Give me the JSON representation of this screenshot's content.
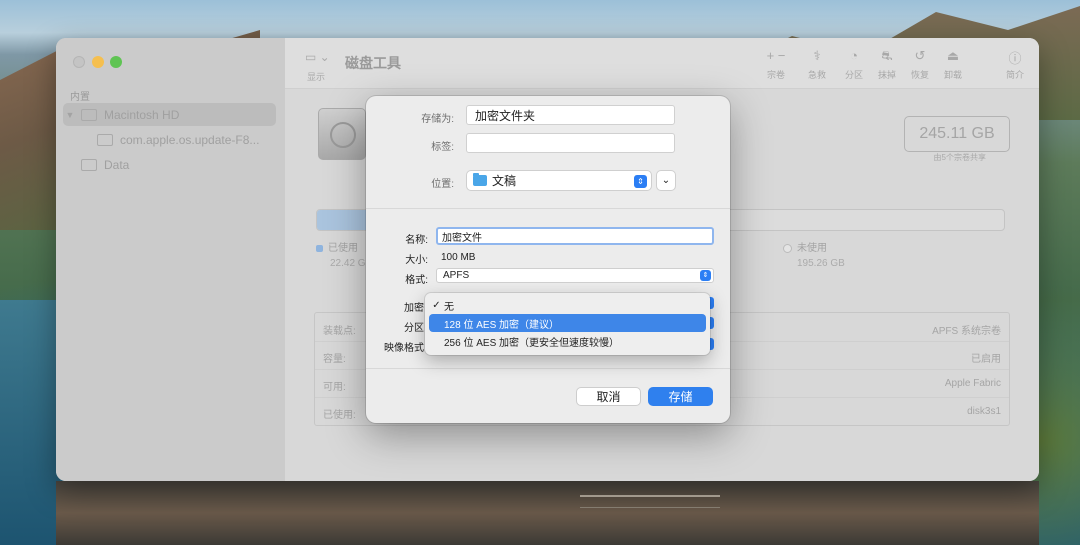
{
  "window": {
    "title": "磁盘工具",
    "show_label": "显示"
  },
  "toolbar": {
    "tools": [
      {
        "icon": "plus-minus-icon",
        "glyph": "+ −",
        "label": "宗卷"
      },
      {
        "icon": "stethoscope-icon",
        "glyph": "⚕",
        "label": "急救"
      },
      {
        "icon": "pie-icon",
        "glyph": "◔",
        "label": "分区"
      },
      {
        "icon": "car-icon",
        "glyph": "⛐",
        "label": "抹掉"
      },
      {
        "icon": "restore-icon",
        "glyph": "↺",
        "label": "恢复"
      },
      {
        "icon": "eject-icon",
        "glyph": "⏏",
        "label": "卸载"
      },
      {
        "icon": "info-icon",
        "glyph": "ⓘ",
        "label": "简介"
      }
    ]
  },
  "sidebar": {
    "section": "内置",
    "items": [
      {
        "label": "Macintosh HD",
        "selected": true
      },
      {
        "label": "com.apple.os.update-F8..."
      },
      {
        "label": "Data"
      }
    ]
  },
  "volume": {
    "capacity": "245.11 GB",
    "capacity_sub": "由5个宗卷共享",
    "used_fraction": 0.091,
    "legend_used": "已使用",
    "legend_used_value": "22.42 G",
    "legend_free": "未使用",
    "legend_free_value": "195.26 GB"
  },
  "info": {
    "rows": [
      {
        "key": "装载点:",
        "value": "APFS 系统宗卷"
      },
      {
        "key": "容量:",
        "value": "已启用"
      },
      {
        "key": "可用:",
        "value": "Apple Fabric"
      },
      {
        "key": "已使用:",
        "value": "disk3s1"
      }
    ]
  },
  "dialog": {
    "save_as_label": "存储为:",
    "save_as_value": "加密文件夹",
    "tags_label": "标签:",
    "tags_value": "",
    "where_label": "位置:",
    "where_value": "文稿",
    "name_label": "名称:",
    "name_value": "加密文件",
    "size_label": "大小:",
    "size_value": "100 MB",
    "format_label": "格式:",
    "format_value": "APFS",
    "encryption_label": "加密",
    "partition_label": "分区",
    "image_format_label": "映像格式",
    "cancel": "取消",
    "save": "存储"
  },
  "encryption_menu": {
    "items": [
      {
        "label": "无",
        "checked": true
      },
      {
        "label": "128 位 AES 加密（建议）",
        "highlighted": true
      },
      {
        "label": "256 位 AES 加密（更安全但速度较慢）"
      }
    ]
  },
  "colors": {
    "accent": "#2f80ee",
    "menu_highlight": "#3e86e8",
    "close": "#c4c4c4",
    "minimize": "#f5bf4f",
    "maximize": "#5fc453"
  }
}
